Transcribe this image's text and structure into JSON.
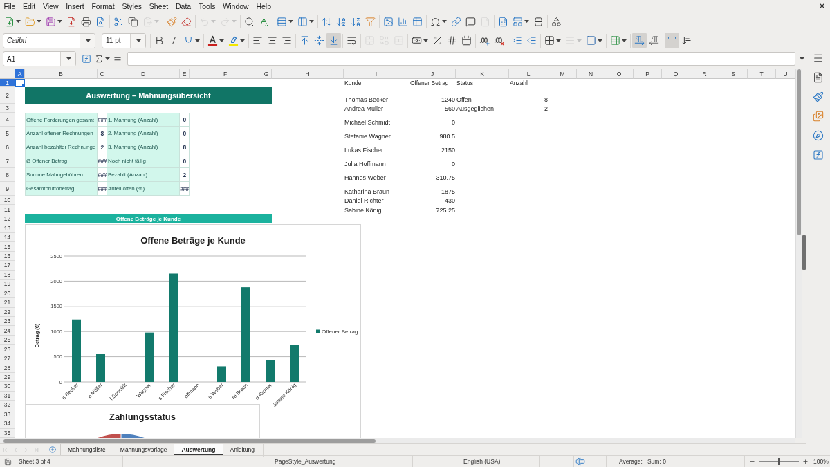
{
  "menu_bar": {
    "items": [
      "File",
      "Edit",
      "View",
      "Insert",
      "Format",
      "Styles",
      "Sheet",
      "Data",
      "Tools",
      "Window",
      "Help"
    ]
  },
  "standard_toolbar": {
    "paste": {
      "disabled": true
    },
    "undo": {
      "disabled": true
    },
    "redo": {
      "disabled": true
    },
    "header_footer": {
      "disabled": true
    }
  },
  "formatting_toolbar": {
    "font_name": "Calibri",
    "font_size": "11 pt",
    "align_bottom": {
      "pressed": true
    },
    "merge_center": {
      "disabled": true
    },
    "merge": {
      "disabled": true
    },
    "unmerge": {
      "disabled": true
    },
    "border_style": {
      "disabled": true
    },
    "left_to_right": {
      "pressed": true
    },
    "text_horizontal": {
      "pressed": true
    }
  },
  "formula_bar": {
    "name_box": "A1"
  },
  "sheet": {
    "column_headers": [
      {
        "label": "A",
        "selected": true
      },
      {
        "label": "B",
        "selected": false
      },
      {
        "label": "C",
        "selected": false
      },
      {
        "label": "D",
        "selected": false
      },
      {
        "label": "E",
        "selected": false
      },
      {
        "label": "F",
        "selected": false
      },
      {
        "label": "G",
        "selected": false
      },
      {
        "label": "H",
        "selected": false
      },
      {
        "label": "I",
        "selected": false
      },
      {
        "label": "J",
        "selected": false
      },
      {
        "label": "K",
        "selected": false
      },
      {
        "label": "L",
        "selected": false
      },
      {
        "label": "M",
        "selected": false
      },
      {
        "label": "N",
        "selected": false
      },
      {
        "label": "O",
        "selected": false
      },
      {
        "label": "P",
        "selected": false
      },
      {
        "label": "Q",
        "selected": false
      },
      {
        "label": "R",
        "selected": false
      },
      {
        "label": "S",
        "selected": false
      },
      {
        "label": "T",
        "selected": false
      },
      {
        "label": "U",
        "selected": false
      }
    ],
    "row_headers": [
      {
        "label": "1",
        "selected": true
      },
      {
        "label": "2",
        "selected": false
      },
      {
        "label": "3",
        "selected": false
      },
      {
        "label": "4",
        "selected": false
      },
      {
        "label": "5",
        "selected": false
      },
      {
        "label": "6",
        "selected": false
      },
      {
        "label": "7",
        "selected": false
      },
      {
        "label": "8",
        "selected": false
      },
      {
        "label": "9",
        "selected": false
      },
      {
        "label": "10",
        "selected": false
      },
      {
        "label": "11",
        "selected": false
      },
      {
        "label": "12",
        "selected": false
      },
      {
        "label": "13",
        "selected": false
      },
      {
        "label": "14",
        "selected": false
      },
      {
        "label": "15",
        "selected": false
      },
      {
        "label": "16",
        "selected": false
      },
      {
        "label": "17",
        "selected": false
      },
      {
        "label": "18",
        "selected": false
      },
      {
        "label": "19",
        "selected": false
      },
      {
        "label": "20",
        "selected": false
      },
      {
        "label": "21",
        "selected": false
      },
      {
        "label": "22",
        "selected": false
      },
      {
        "label": "23",
        "selected": false
      },
      {
        "label": "24",
        "selected": false
      },
      {
        "label": "25",
        "selected": false
      },
      {
        "label": "26",
        "selected": false
      },
      {
        "label": "27",
        "selected": false
      },
      {
        "label": "28",
        "selected": false
      },
      {
        "label": "29",
        "selected": false
      },
      {
        "label": "30",
        "selected": false
      },
      {
        "label": "31",
        "selected": false
      },
      {
        "label": "32",
        "selected": false
      },
      {
        "label": "33",
        "selected": false
      },
      {
        "label": "34",
        "selected": false
      },
      {
        "label": "35",
        "selected": false
      }
    ],
    "title_banner": "Auswertung – Mahnungsübersicht",
    "kpi_table": {
      "rows": [
        {
          "left_label": "Offene Forderungen gesamt",
          "left_value": "###",
          "right_label": "1. Mahnung (Anzahl)",
          "right_value": "0"
        },
        {
          "left_label": "Anzahl offener Rechnungen",
          "left_value": "8",
          "right_label": "2. Mahnung (Anzahl)",
          "right_value": "0"
        },
        {
          "left_label": "Anzahl bezahlter Rechnunge",
          "left_value": "2",
          "right_label": "3. Mahnung (Anzahl)",
          "right_value": "8"
        },
        {
          "left_label": "Ø Offener Betrag",
          "left_value": "###",
          "right_label": "Noch nicht fällig",
          "right_value": "0"
        },
        {
          "left_label": "Summe Mahngebühren",
          "left_value": "###",
          "right_label": "Bezahlt (Anzahl)",
          "right_value": "2"
        },
        {
          "left_label": "Gesamtbruttobetrag",
          "left_value": "###",
          "right_label": "Anteil offen (%)",
          "right_value": "###"
        }
      ]
    },
    "section_banner": "Offene Beträge je Kunde",
    "customer_table": {
      "columns": [
        "Kunde",
        "Offener Betrag"
      ],
      "rows": [
        {
          "customer": "Thomas Becker",
          "amount": "1240"
        },
        {
          "customer": "Andrea Müller",
          "amount": "560"
        },
        {
          "customer": "Michael Schmidt",
          "amount": "0"
        },
        {
          "customer": "Stefanie Wagner",
          "amount": "980.5"
        },
        {
          "customer": "Lukas Fischer",
          "amount": "2150"
        },
        {
          "customer": "Julia Hoffmann",
          "amount": "0"
        },
        {
          "customer": "Hannes Weber",
          "amount": "310.75"
        },
        {
          "customer": "Katharina Braun",
          "amount": "1875"
        },
        {
          "customer": "Daniel Richter",
          "amount": "430"
        },
        {
          "customer": "Sabine König",
          "amount": "725.25"
        }
      ]
    },
    "status_table": {
      "columns": [
        "Status",
        "Anzahl"
      ],
      "rows": [
        {
          "status": "Offen",
          "count": "8"
        },
        {
          "status": "Ausgeglichen",
          "count": "2"
        }
      ]
    },
    "amounts_chart": {
      "chart_data": {
        "type": "bar",
        "title": "Offene Beträge je Kunde",
        "ylabel": "Betrag (€)",
        "categories": [
          "s Becker",
          "a Müller",
          "l Schmidt",
          "Wagner",
          "s Fischer",
          "offmann",
          "s Weber",
          "ra Braun",
          "d Richter",
          "Sabine König"
        ],
        "series": [
          {
            "name": "Offener Betrag",
            "color": "#127a6c",
            "values": [
              1240,
              560,
              0,
              980,
              2150,
              0,
              310,
              1880,
              430,
              730
            ]
          }
        ],
        "ylim": [
          0,
          2500
        ],
        "yticks": [
          0,
          500,
          1000,
          1500,
          2000,
          2500
        ],
        "grid": true
      }
    },
    "status_chart": {
      "title": "Zahlungsstatus"
    }
  },
  "sheet_navigation": {
    "disabled": true
  },
  "sheet_tabs": [
    {
      "label": "Mahnungsliste",
      "selected": false
    },
    {
      "label": "Mahnungsvorlage",
      "selected": false
    },
    {
      "label": "Auswertung",
      "selected": true
    },
    {
      "label": "Anleitung",
      "selected": false
    }
  ],
  "status_bar": {
    "sheet": "Sheet 3 of 4",
    "page_style": "PageStyle_Auswertung",
    "language": "English (USA)",
    "selection_summary": "Average: ; Sum: 0",
    "zoom": {
      "level": 0.5,
      "reading": "100%"
    }
  }
}
